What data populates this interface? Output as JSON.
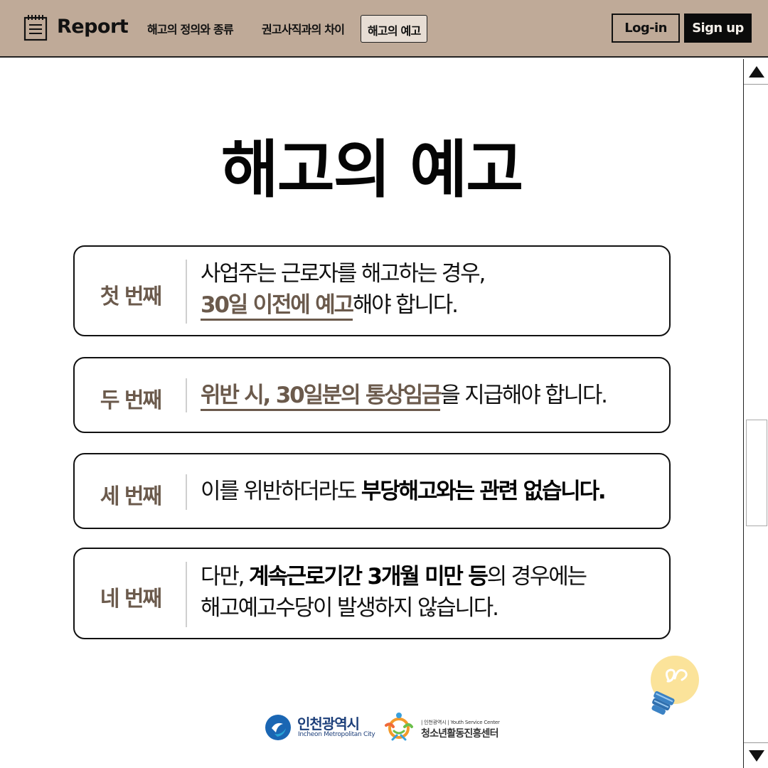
{
  "header": {
    "logo": "Report",
    "nav": [
      "해고의 정의와 종류",
      "권고사직과의 차이",
      "해고의 예고"
    ],
    "active_nav": "해고의 예고",
    "login": "Log-in",
    "signup": "Sign up"
  },
  "main": {
    "title": "해고의 예고",
    "cards": [
      {
        "label": "첫 번째",
        "line1": "사업주는 근로자를 해고하는 경우,",
        "line2_highlight": "30일 이전에 예고",
        "line2_rest": "해야 합니다."
      },
      {
        "label": "두 번째",
        "highlight": "위반 시, 30일분의 통상임금",
        "rest": "을 지급해야 합니다."
      },
      {
        "label": "세 번째",
        "prefix": "이를 위반하더라도 ",
        "bold": "부당해고와는 관련 없습니다."
      },
      {
        "label": "네 번째",
        "line1_prefix": "다만, ",
        "line1_bold": "계속근로기간 3개월 미만 등",
        "line1_rest": "의 경우에는",
        "line2": "해고예고수당이 발생하지 않습니다."
      }
    ]
  },
  "footer": {
    "incheon_name": "인천광역시",
    "incheon_en": "Incheon Metropolitan City",
    "youth_small": "| 인천광역시 | Youth Service Center",
    "youth_name": "청소년활동진흥센터"
  },
  "colors": {
    "header_bg": "#bfaa98",
    "accent": "#6b5a4c",
    "signup_bg": "#0b0b0b"
  }
}
